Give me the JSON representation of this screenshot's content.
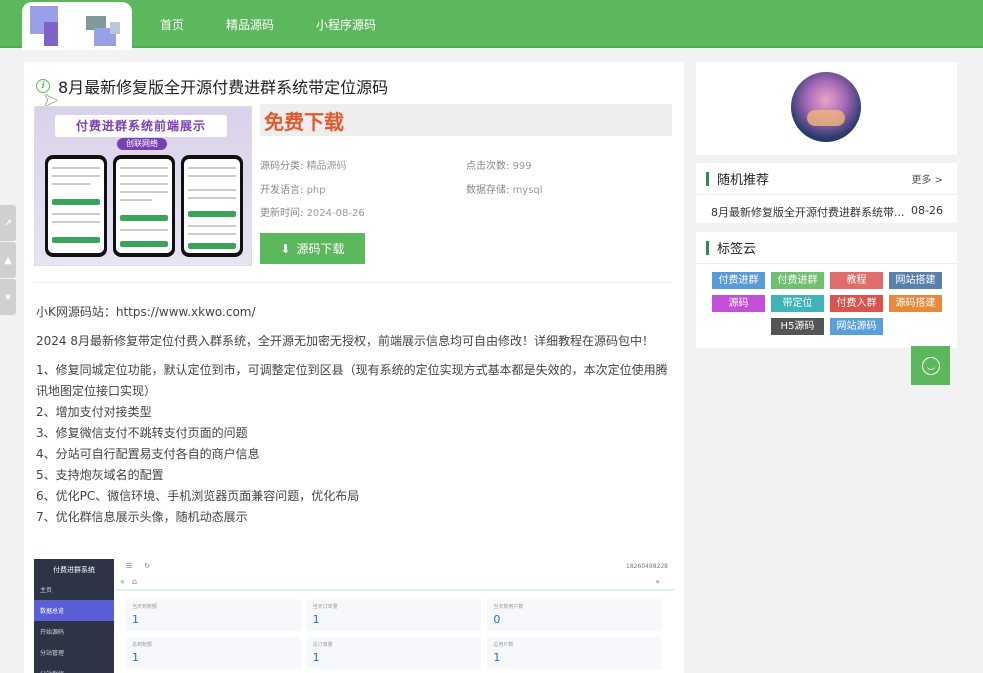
{
  "nav": {
    "items": [
      "首页",
      "精品源码",
      "小程序源码"
    ]
  },
  "article": {
    "title": "8月最新修复版全开源付费进群系统带定位源码",
    "thumb_banner": "付费进群系统前端展示",
    "thumb_sub": "创联网络",
    "free_label": "免费下载",
    "meta": {
      "category_label": "源码分类:",
      "category_value": "精品源码",
      "clicks_label": "点击次数:",
      "clicks_value": "999",
      "lang_label": "开发语言:",
      "lang_value": "php",
      "storage_label": "数据存储:",
      "storage_value": "mysql",
      "updated_label": "更新时间:",
      "updated_value": "2024-08-26"
    },
    "download_label": "源码下载",
    "site_line": "小K网源码站：https://www.xkwo.com/",
    "intro": "2024 8月最新修复带定位付费入群系统，全开源无加密无授权，前端展示信息均可自由修改！详细教程在源码包中！",
    "list": [
      "1、修复同城定位功能，默认定位到市，可调整定位到区县（现有系统的定位实现方式基本都是失效的，本次定位使用腾讯地图定位接口实现）",
      "2、增加支付对接类型",
      "3、修复微信支付不跳转支付页面的问题",
      "4、分站可自行配置易支付各自的商户信息",
      "5、支持炮灰域名的配置",
      "6、优化PC、微信环境、手机浏览器页面兼容问题，优化布局",
      "7、优化群信息展示头像，随机动态展示"
    ]
  },
  "shot": {
    "brand": "付费进群系统",
    "menu": [
      "主页",
      "数据总览",
      "开始源码",
      "分站管理",
      "分站群组"
    ],
    "phone": "18260498228",
    "cards": [
      {
        "label": "当天到账额",
        "value": "1"
      },
      {
        "label": "当天订单量",
        "value": "1"
      },
      {
        "label": "当天新用户数",
        "value": "0"
      },
      {
        "label": "总到账额",
        "value": "1"
      },
      {
        "label": "总订单量",
        "value": "1"
      },
      {
        "label": "总用户数",
        "value": "1"
      }
    ]
  },
  "random": {
    "title": "随机推荐",
    "more": "更多 >",
    "item_title": "8月最新修复版全开源付费进群系统带...",
    "item_date": "08-26"
  },
  "tagcloud": {
    "title": "标签云",
    "tags": [
      {
        "label": "付费进群",
        "color": "#5b9bd5"
      },
      {
        "label": "付费进群",
        "color": "#70c070"
      },
      {
        "label": "教程",
        "color": "#e06c6c"
      },
      {
        "label": "网站搭建",
        "color": "#5a7fa8"
      },
      {
        "label": "源码",
        "color": "#c34fd8"
      },
      {
        "label": "带定位",
        "color": "#3fb3b5"
      },
      {
        "label": "付费入群",
        "color": "#d9534f"
      },
      {
        "label": "源码搭建",
        "color": "#e8883a"
      },
      {
        "label": "H5源码",
        "color": "#555555"
      },
      {
        "label": "网站源码",
        "color": "#5aa0d8"
      }
    ]
  },
  "colors": {
    "brand_green": "#5cb85c",
    "free_orange": "#e05a2b"
  }
}
